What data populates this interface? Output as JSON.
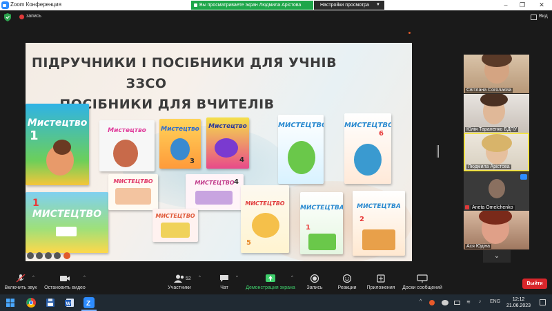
{
  "window": {
    "title": "Zoom Конференция",
    "share_banner": "Вы просматриваете экран Людмила Арістова",
    "view_options": "Настройки просмотра"
  },
  "meeting": {
    "record_label": "запись",
    "view_label": "Вид"
  },
  "slide": {
    "title_line1": "ПІДРУЧНИКИ І ПОСІБНИКИ ДЛЯ УЧНІВ",
    "title_line2": "ЗЗСО",
    "title_line3": "ПОСІБНИКИ ДЛЯ ВЧИТЕЛІВ",
    "book_title": "МИСТЕЦТВО",
    "book_title_variant": "Мистецтво",
    "book_title_digital": "МИСТЕЦТВА",
    "grade_numbers": [
      "1",
      "2",
      "3",
      "4",
      "5",
      "6"
    ]
  },
  "participants": [
    {
      "name": "Світлана Соголаєва",
      "accent": "#7a5a48"
    },
    {
      "name": "Юлія Тараненко БДПУ",
      "accent": "#6a4a3a"
    },
    {
      "name": "Людмила Арістова",
      "accent": "#c9a56a",
      "active": true
    },
    {
      "name": "Aneta Omelchenko",
      "accent": "#4a4a4a"
    },
    {
      "name": "Ася Юдіна",
      "accent": "#8a3a2a"
    }
  ],
  "toolbar": {
    "audio": "Включить звук",
    "video": "Остановить видео",
    "participants": "Участники",
    "participants_count": "52",
    "chat": "Чат",
    "share": "Демонстрация экрана",
    "record": "Запись",
    "reactions": "Реакции",
    "apps": "Приложения",
    "whiteboard": "Доски сообщений",
    "leave": "Выйти"
  },
  "taskbar": {
    "language": "ENG",
    "time": "12:12",
    "date": "21.06.2023"
  },
  "colors": {
    "share_green": "#1ea64a",
    "leave_red": "#d8262b",
    "active_border": "#f2e34c"
  }
}
